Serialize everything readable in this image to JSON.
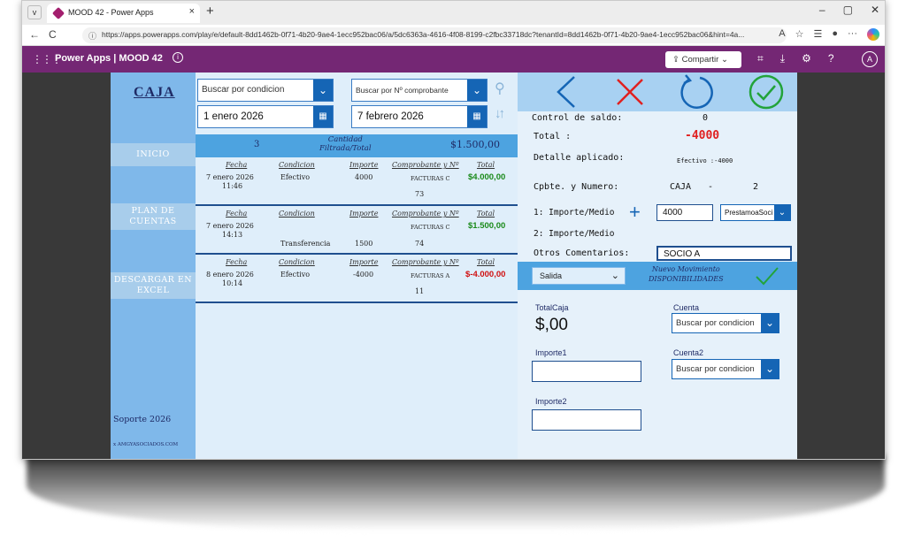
{
  "browser": {
    "tab_menu": "v",
    "tab_title": "MOOD 42 - Power Apps",
    "tab_close": "×",
    "new_tab": "+",
    "win_min": "–",
    "win_max": "▢",
    "win_close": "✕",
    "back": "←",
    "reload": "C",
    "url": "https://apps.powerapps.com/play/e/default-8dd1462b-0f71-4b20-9ae4-1ecc952bac06/a/5dc6363a-4616-4f08-8199-c2fbc33718dc?tenantId=8dd1462b-0f71-4b20-9ae4-1ecc952bac06&hint=4a...",
    "more": "···"
  },
  "header": {
    "app_title": "Power Apps  |  MOOD 42",
    "share_label": "Compartir",
    "avatar": "A"
  },
  "sidebar": {
    "title": "CAJA",
    "items": [
      {
        "label": "INICIO"
      },
      {
        "label": "PLAN DE\nCUENTAS"
      },
      {
        "label": "DESCARGAR EN\nEXCEL"
      }
    ],
    "support": "Soporte 2026",
    "company": "x AMGYASOCIADOS.COM"
  },
  "filters": {
    "condition_placeholder": "Buscar por condicion",
    "voucher_placeholder": "Buscar por Nº comprobante",
    "date_from": "1 enero 2026",
    "date_to": "7 febrero 2026"
  },
  "list": {
    "count": "3",
    "count_label": "Cantidad\nFiltrada/Total",
    "total": "$1.500,00",
    "headers": {
      "fecha": "Fecha",
      "condicion": "Condicion",
      "importe": "Importe",
      "comprobante": "Comprobante y Nº",
      "total": "Total"
    },
    "records": [
      {
        "fecha": "7 enero 2026",
        "hora": "11:46",
        "condicion": "Efectivo",
        "importe": "4000",
        "comprobante": "FACTURAS C",
        "numero": "73",
        "total": "$4.000,00",
        "total_color": "#1a8a1a"
      },
      {
        "fecha": "7 enero 2026",
        "hora": "14:13",
        "condicion": "Transferencia",
        "importe": "1500",
        "comprobante": "FACTURAS C",
        "numero": "74",
        "total": "$1.500,00",
        "total_color": "#1a8a1a"
      },
      {
        "fecha": "8 enero 2026",
        "hora": "10:14",
        "condicion": "Efectivo",
        "importe": "-4000",
        "comprobante": "FACTURAS A",
        "numero": "11",
        "total": "$-4.000,00",
        "total_color": "#d01010"
      }
    ]
  },
  "detail": {
    "control_label": "Control de saldo:",
    "control_value": "0",
    "total_label": "Total :",
    "total_value": "-4000",
    "detalle_label": "Detalle aplicado:",
    "detalle_value": "Efectivo :-4000",
    "cpbte_label": "Cpbte. y Numero:",
    "cpbte_type": "CAJA",
    "cpbte_sep": "-",
    "cpbte_num": "2",
    "importe1_label": "1: Importe/Medio",
    "importe1_value": "4000",
    "medio1_value": "PrestamoaSoci",
    "importe2_label": "2: Importe/Medio",
    "comentarios_label": "Otros Comentarios:",
    "comentarios_value": "SOCIO A"
  },
  "movement": {
    "type_value": "Salida",
    "caption": "Nuevo Movimiento\nDISPONIBILIDADES"
  },
  "form": {
    "totalcaja_label": "TotalCaja",
    "totalcaja_value": "$,00",
    "cuenta_label": "Cuenta",
    "cuenta_placeholder": "Buscar por condicion",
    "importe1_label": "Importe1",
    "cuenta2_label": "Cuenta2",
    "cuenta2_placeholder": "Buscar por condicion",
    "importe2_label": "Importe2"
  },
  "colors": {
    "header_purple": "#742774",
    "accent_blue": "#1565b5",
    "confirm_green": "#22a33a",
    "cancel_red": "#e02020"
  }
}
